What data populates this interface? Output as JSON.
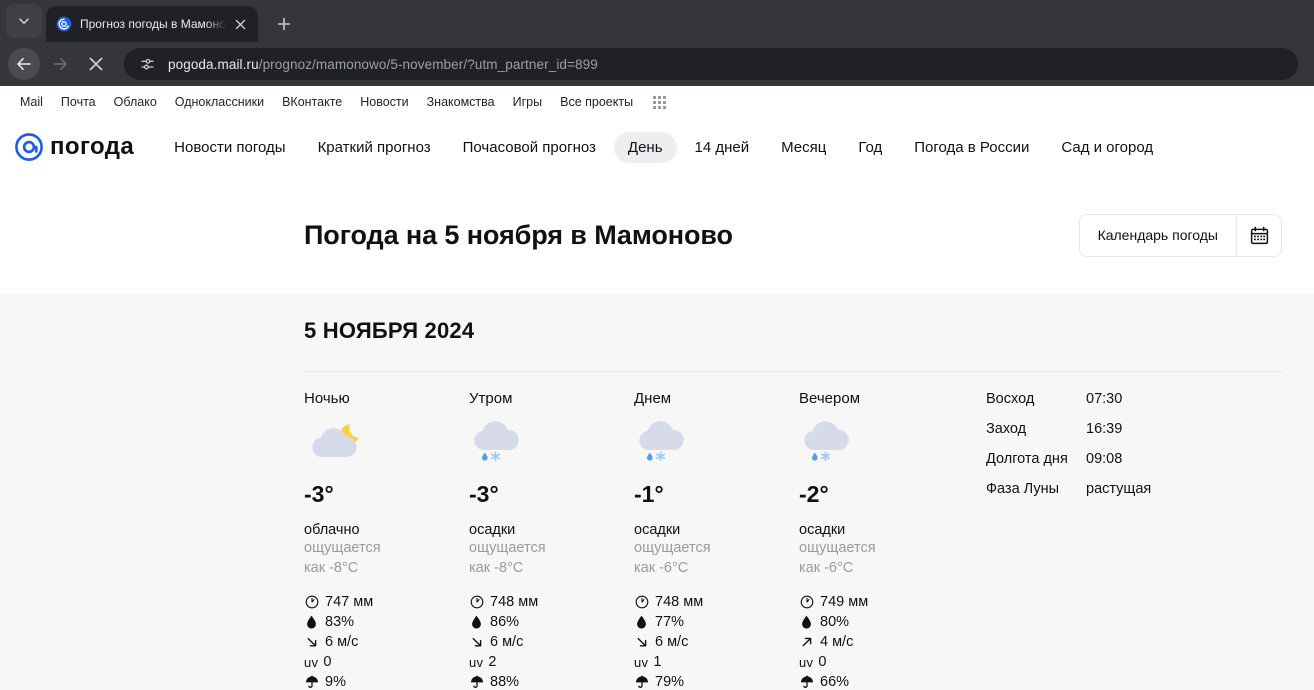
{
  "browser": {
    "tab": {
      "title": "Прогноз погоды в Мамоново",
      "favicon_name": "mail-ru-weather-favicon"
    },
    "new_tab_label": "+",
    "url_prefix": "pogoda.mail.ru",
    "url_suffix": "/prognoz/mamonowo/5-november/?utm_partner_id=899"
  },
  "mailbar": {
    "links": [
      "Mail",
      "Почта",
      "Облако",
      "Одноклассники",
      "ВКонтакте",
      "Новости",
      "Знакомства",
      "Игры",
      "Все проекты"
    ]
  },
  "sitenav": {
    "logo_text": "погода",
    "links": [
      {
        "label": "Новости погоды",
        "active": false
      },
      {
        "label": "Краткий прогноз",
        "active": false
      },
      {
        "label": "Почасовой прогноз",
        "active": false
      },
      {
        "label": "День",
        "active": true
      },
      {
        "label": "14 дней",
        "active": false
      },
      {
        "label": "Месяц",
        "active": false
      },
      {
        "label": "Год",
        "active": false
      },
      {
        "label": "Погода в России",
        "active": false
      },
      {
        "label": "Сад и огород",
        "active": false
      }
    ]
  },
  "header": {
    "page_title": "Погода на 5 ноября в Мамоново",
    "calendar_button": "Календарь погоды"
  },
  "content": {
    "date_heading": "5 НОЯБРЯ 2024",
    "cards": [
      {
        "title": "Ночью",
        "icon": "cloud-moon-icon",
        "temp": "-3°",
        "desc": "облачно",
        "feels_line1": "ощущается",
        "feels_line2": "как -8°C",
        "pressure": "747 мм",
        "humidity": "83%",
        "wind": "6 м/с",
        "wind_dir": "down-right",
        "uv_label": "uv",
        "uv": "0",
        "precip": "9%"
      },
      {
        "title": "Утром",
        "icon": "cloud-rain-snow-icon",
        "temp": "-3°",
        "desc": "осадки",
        "feels_line1": "ощущается",
        "feels_line2": "как -8°C",
        "pressure": "748 мм",
        "humidity": "86%",
        "wind": "6 м/с",
        "wind_dir": "down-right",
        "uv_label": "uv",
        "uv": "2",
        "precip": "88%"
      },
      {
        "title": "Днем",
        "icon": "cloud-rain-snow-icon",
        "temp": "-1°",
        "desc": "осадки",
        "feels_line1": "ощущается",
        "feels_line2": "как -6°C",
        "pressure": "748 мм",
        "humidity": "77%",
        "wind": "6 м/с",
        "wind_dir": "down-right",
        "uv_label": "uv",
        "uv": "1",
        "precip": "79%"
      },
      {
        "title": "Вечером",
        "icon": "cloud-rain-snow-icon",
        "temp": "-2°",
        "desc": "осадки",
        "feels_line1": "ощущается",
        "feels_line2": "как -6°C",
        "pressure": "749 мм",
        "humidity": "80%",
        "wind": "4 м/с",
        "wind_dir": "up-right",
        "uv_label": "uv",
        "uv": "0",
        "precip": "66%"
      }
    ],
    "sun": [
      {
        "label": "Восход",
        "value": "07:30"
      },
      {
        "label": "Заход",
        "value": "16:39"
      },
      {
        "label": "Долгота дня",
        "value": "09:08"
      },
      {
        "label": "Фаза Луны",
        "value": "растущая"
      }
    ]
  },
  "colors": {
    "accent_blue": "#1b5ce8",
    "cloud": "#d7dae9",
    "moon": "#ffcf3f",
    "raindrop": "#4f9ef0",
    "snowflake": "#9ecbf5",
    "chrome_bg": "#35363a",
    "content_bg": "#f7f7f8"
  }
}
